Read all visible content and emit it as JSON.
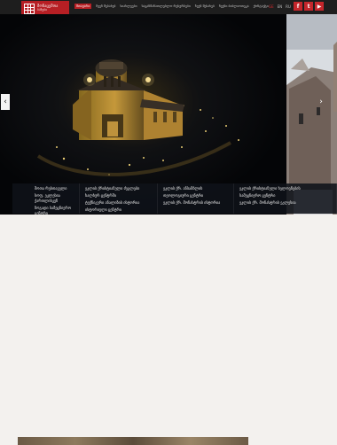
{
  "logo": {
    "line1": "მონაცემთა",
    "line2": "ბაზები"
  },
  "nav": [
    {
      "label": "მთავარი",
      "active": true
    },
    {
      "label": "ჩვენ შესახებ"
    },
    {
      "label": "სიახლეები"
    },
    {
      "label": "საგანმანათლებლო რესურსები"
    },
    {
      "label": "ჩვენ შესახებ"
    },
    {
      "label": "ჩვენი ბიბლიოთეკა"
    },
    {
      "label": "ქონტაქტი"
    }
  ],
  "languages": [
    {
      "label": "GE",
      "active": true
    },
    {
      "label": "EN"
    },
    {
      "label": "RU"
    }
  ],
  "social": [
    {
      "icon": "facebook-icon",
      "glyph": "f"
    },
    {
      "icon": "twitter-icon",
      "glyph": "t"
    },
    {
      "icon": "youtube-icon",
      "glyph": "▶"
    }
  ],
  "slider": {
    "prev": "‹",
    "next": "›"
  },
  "cards": [
    {
      "lines": [
        "შოთა რუსთაველი",
        "სოფ. ეკლესია ქართლისკენ",
        "ზოგადი სამეცნიერო ცენტრი"
      ]
    },
    {
      "lines": [
        "ეკლის ქრისტიანული ძეგლები",
        "ხალხურ ცენტრში",
        "ტექნიკური ანალიზის ისტორია",
        "ისტორიული ცენტრი"
      ]
    },
    {
      "lines": [
        "ეკლის ქრ. ანსამბლის",
        "თეოლოგიური ცენტრი",
        "ეკლის ქრ. მონასტრის ისტორია"
      ]
    },
    {
      "lines": [
        "ეკლის ქრისტიანული ხელოვნების",
        "სამეცნიერო ცენტრი",
        "ეკლის ქრ. მონასტრის ეკლესია"
      ]
    }
  ],
  "colors": {
    "accent": "#b71f24",
    "header_bg": "#1e1e1e"
  }
}
